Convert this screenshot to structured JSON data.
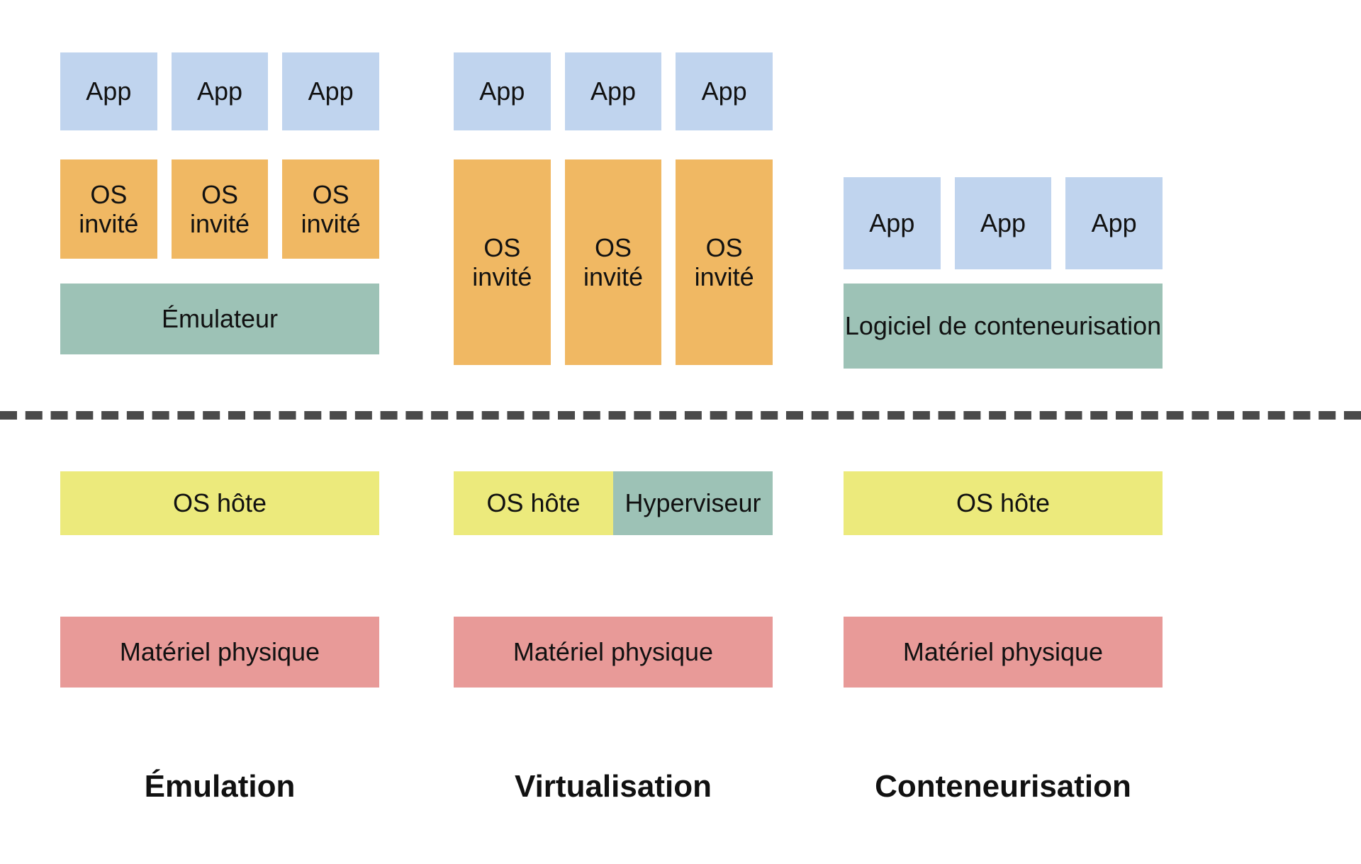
{
  "labels": {
    "app": "App",
    "guest_os": "OS invité",
    "emulator": "Émulateur",
    "container_software": "Logiciel de conteneurisation",
    "host_os": "OS hôte",
    "hypervisor": "Hyperviseur",
    "hardware": "Matériel physique"
  },
  "columns": {
    "emulation": {
      "title": "Émulation"
    },
    "virtualization": {
      "title": "Virtualisation"
    },
    "containerization": {
      "title": "Conteneurisation"
    }
  }
}
